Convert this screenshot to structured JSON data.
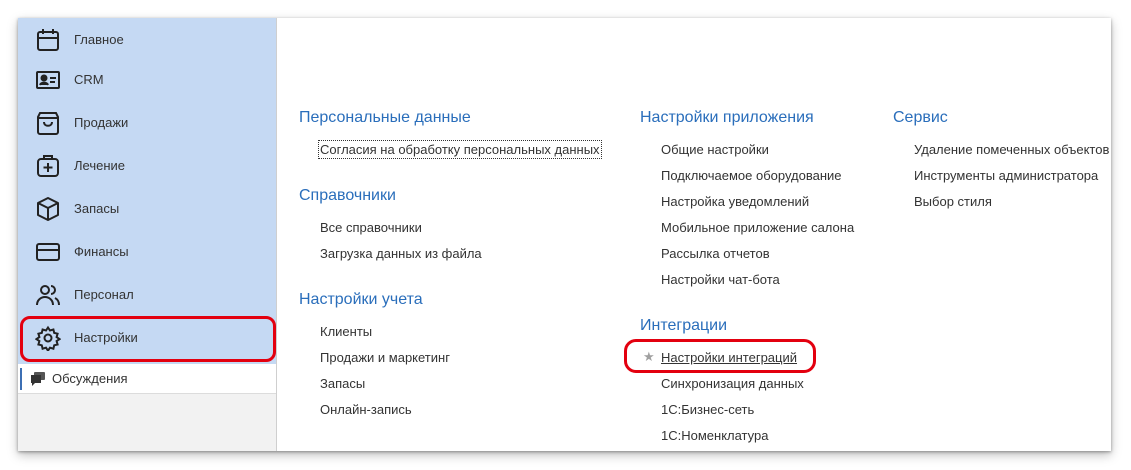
{
  "sidebar": {
    "items": [
      {
        "label": "Главное",
        "icon": "calendar-icon"
      },
      {
        "label": "CRM",
        "icon": "id-card-icon"
      },
      {
        "label": "Продажи",
        "icon": "shopping-bag-icon"
      },
      {
        "label": "Лечение",
        "icon": "medical-case-icon"
      },
      {
        "label": "Запасы",
        "icon": "box-icon"
      },
      {
        "label": "Финансы",
        "icon": "credit-card-icon"
      },
      {
        "label": "Персонал",
        "icon": "users-icon"
      },
      {
        "label": "Настройки",
        "icon": "gear-icon"
      }
    ],
    "active_item": "Настройки",
    "discussions": {
      "label": "Обсуждения",
      "icon": "chat-icon"
    }
  },
  "main": {
    "col1": {
      "personal": {
        "title": "Персональные данные",
        "links": [
          "Согласия на обработку персональных данных"
        ]
      },
      "directories": {
        "title": "Справочники",
        "links": [
          "Все справочники",
          "Загрузка данных из файла"
        ]
      },
      "accounting": {
        "title": "Настройки учета",
        "links": [
          "Клиенты",
          "Продажи и маркетинг",
          "Запасы",
          "Онлайн-запись"
        ]
      }
    },
    "col2": {
      "app_settings": {
        "title": "Настройки приложения",
        "links": [
          "Общие настройки",
          "Подключаемое оборудование",
          "Настройка уведомлений",
          "Мобильное приложение салона",
          "Рассылка отчетов",
          "Настройки чат-бота"
        ]
      },
      "integrations": {
        "title": "Интеграции",
        "links": [
          "Настройки интеграций",
          "Синхронизация данных",
          "1С:Бизнес-сеть",
          "1С:Номенклатура"
        ]
      }
    },
    "col3": {
      "service": {
        "title": "Сервис",
        "links": [
          "Удаление помеченных объектов",
          "Инструменты администратора",
          "Выбор стиля"
        ]
      }
    }
  },
  "colors": {
    "nav_bg": "#c5d9f3",
    "section_title": "#2a6ebb",
    "highlight": "#e3000f"
  }
}
